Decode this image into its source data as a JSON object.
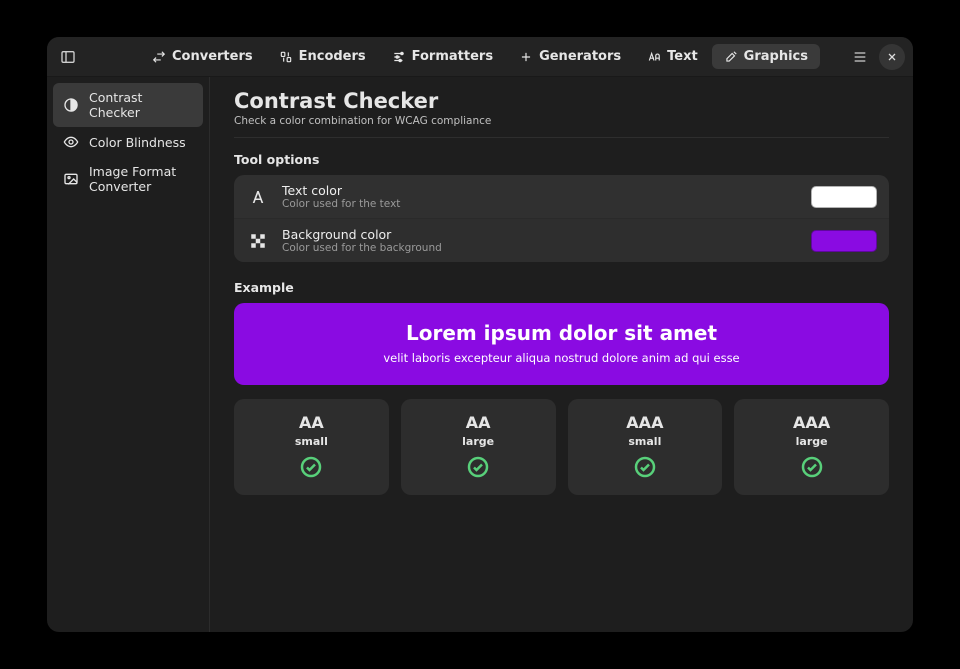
{
  "tabs": {
    "converters": "Converters",
    "encoders": "Encoders",
    "formatters": "Formatters",
    "generators": "Generators",
    "text": "Text",
    "graphics": "Graphics"
  },
  "sidebar": {
    "items": [
      {
        "label": "Contrast Checker"
      },
      {
        "label": "Color Blindness"
      },
      {
        "label": "Image Format Converter"
      }
    ]
  },
  "page": {
    "title": "Contrast Checker",
    "subtitle": "Check a color combination for WCAG compliance"
  },
  "sections": {
    "options": "Tool options",
    "example": "Example"
  },
  "options": {
    "text_color": {
      "title": "Text color",
      "sub": "Color used for the text",
      "hex": "#ffffff"
    },
    "bg_color": {
      "title": "Background color",
      "sub": "Color used for the background",
      "hex": "#8a0be2"
    }
  },
  "example": {
    "title": "Lorem ipsum dolor sit amet",
    "sub": "velit laboris excepteur aliqua nostrud dolore anim ad qui esse"
  },
  "results": [
    {
      "level": "AA",
      "size": "small",
      "pass": true
    },
    {
      "level": "AA",
      "size": "large",
      "pass": true
    },
    {
      "level": "AAA",
      "size": "small",
      "pass": true
    },
    {
      "level": "AAA",
      "size": "large",
      "pass": true
    }
  ]
}
